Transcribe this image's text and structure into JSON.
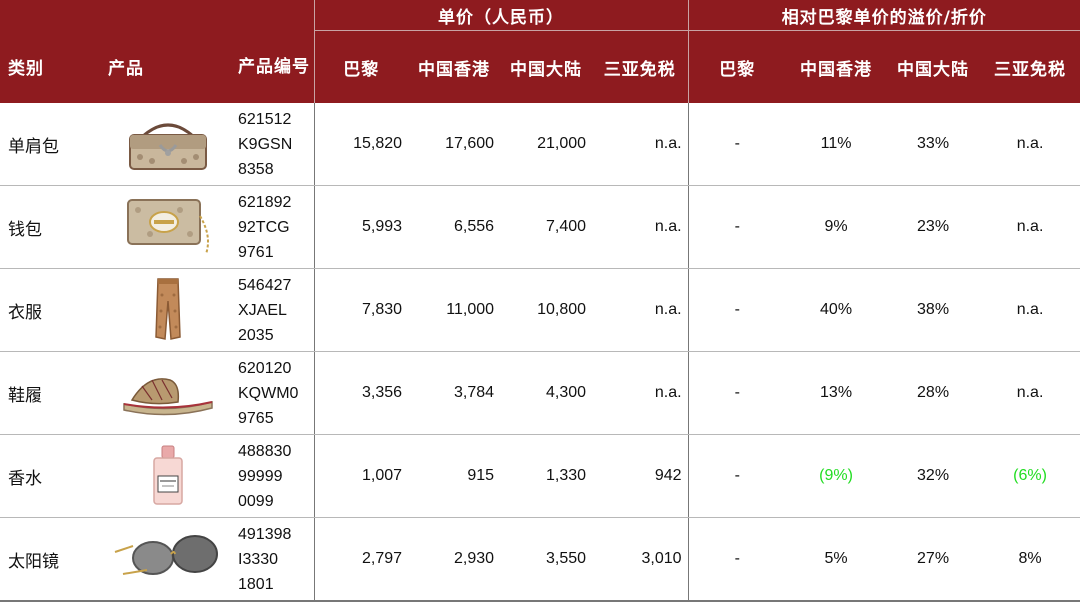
{
  "header": {
    "group_price": "单价（人民币）",
    "group_premium": "相对巴黎单价的溢价/折价",
    "col_category": "类别",
    "col_product": "产品",
    "col_code": "产品编号",
    "price_cols": [
      "巴黎",
      "中国香港",
      "中国大陆",
      "三亚免税"
    ],
    "premium_cols": [
      "巴黎",
      "中国香港",
      "中国大陆",
      "三亚免税"
    ]
  },
  "rows": [
    {
      "category": "单肩包",
      "image": "shoulder-bag-image",
      "code": [
        "621512",
        "K9GSN",
        "8358"
      ],
      "prices": [
        "15,820",
        "17,600",
        "21,000",
        "n.a."
      ],
      "premiums": [
        "-",
        "11%",
        "33%",
        "n.a."
      ]
    },
    {
      "category": "钱包",
      "image": "wallet-image",
      "code": [
        "621892",
        "92TCG",
        "9761"
      ],
      "prices": [
        "5,993",
        "6,556",
        "7,400",
        "n.a."
      ],
      "premiums": [
        "-",
        "9%",
        "23%",
        "n.a."
      ]
    },
    {
      "category": "衣服",
      "image": "pants-image",
      "code": [
        "546427",
        "XJAEL",
        "2035"
      ],
      "prices": [
        "7,830",
        "11,000",
        "10,800",
        "n.a."
      ],
      "premiums": [
        "-",
        "40%",
        "38%",
        "n.a."
      ]
    },
    {
      "category": "鞋履",
      "image": "sandal-image",
      "code": [
        "620120",
        "KQWM0",
        "9765"
      ],
      "prices": [
        "3,356",
        "3,784",
        "4,300",
        "n.a."
      ],
      "premiums": [
        "-",
        "13%",
        "28%",
        "n.a."
      ]
    },
    {
      "category": "香水",
      "image": "perfume-image",
      "code": [
        "488830",
        "99999",
        "0099"
      ],
      "prices": [
        "1,007",
        "915",
        "1,330",
        "942"
      ],
      "premiums": [
        "-",
        "(9%)",
        "32%",
        "(6%)"
      ]
    },
    {
      "category": "太阳镜",
      "image": "sunglasses-image",
      "code": [
        "491398",
        "I3330",
        "1801"
      ],
      "prices": [
        "2,797",
        "2,930",
        "3,550",
        "3,010"
      ],
      "premiums": [
        "-",
        "5%",
        "27%",
        "8%"
      ]
    }
  ],
  "colors": {
    "header_bg": "#8e1b1f",
    "negative": "#22dd22"
  }
}
